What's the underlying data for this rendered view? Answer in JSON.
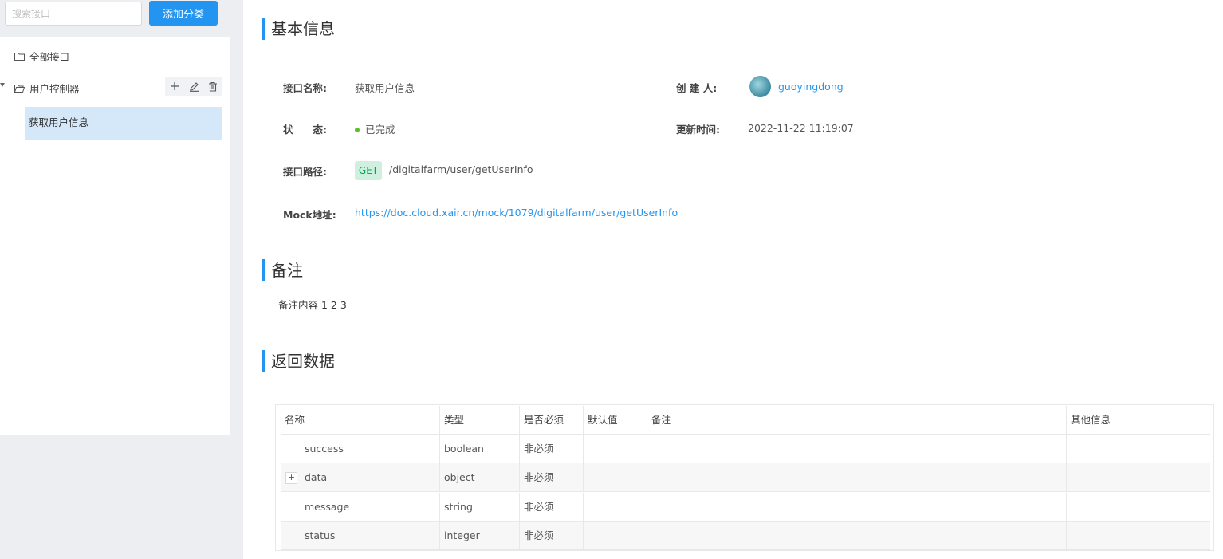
{
  "sidebar": {
    "search_placeholder": "搜索接口",
    "add_category_label": "添加分类",
    "all_interfaces": "全部接口",
    "group": "用户控制器",
    "selected": "获取用户信息"
  },
  "basic": {
    "title": "基本信息",
    "name_label": "接口名称:",
    "name_value": "获取用户信息",
    "creator_label": "创 建 人:",
    "creator_value": "guoyingdong",
    "status_label": "状　　态:",
    "status_value": "已完成",
    "updated_label": "更新时间:",
    "updated_value": "2022-11-22 11:19:07",
    "path_label": "接口路径:",
    "method": "GET",
    "path_value": "/digitalfarm/user/getUserInfo",
    "mock_label": "Mock地址:",
    "mock_value": "https://doc.cloud.xair.cn/mock/1079/digitalfarm/user/getUserInfo"
  },
  "remark": {
    "title": "备注",
    "content": "备注内容 1 2 3"
  },
  "response": {
    "title": "返回数据",
    "headers": [
      "名称",
      "类型",
      "是否必须",
      "默认值",
      "备注",
      "其他信息"
    ],
    "rows": [
      {
        "name": "success",
        "type": "boolean",
        "required": "非必须",
        "expandable": false
      },
      {
        "name": "data",
        "type": "object",
        "required": "非必须",
        "expandable": true
      },
      {
        "name": "message",
        "type": "string",
        "required": "非必须",
        "expandable": false
      },
      {
        "name": "status",
        "type": "integer",
        "required": "非必须",
        "expandable": false
      }
    ]
  },
  "colors": {
    "accent": "#2395f1",
    "success": "#57c22d",
    "get_tag_bg": "#cfefdf",
    "get_tag_text": "#00a854"
  }
}
